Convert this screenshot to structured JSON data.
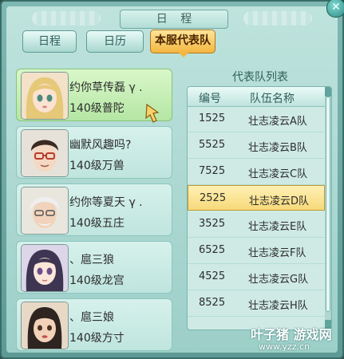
{
  "window": {
    "title": "日 程",
    "close_icon": "close-icon"
  },
  "tabs": [
    {
      "label": "日程"
    },
    {
      "label": "日历"
    },
    {
      "label": "本服代表队",
      "active": true
    }
  ],
  "team": {
    "members": [
      {
        "name": "约你草传磊 γ .",
        "level": "140级普陀",
        "avatar": "blonde-girl-avatar",
        "selected": true
      },
      {
        "name": "幽默风趣吗?",
        "level": "140级万兽",
        "avatar": "glasses-man-avatar"
      },
      {
        "name": "约你等夏天 γ .",
        "level": "140级五庄",
        "avatar": "old-man-avatar"
      },
      {
        "name": "、扈三狼",
        "level": "140级龙宫",
        "avatar": "dark-hair-girl-avatar"
      },
      {
        "name": "、扈三娘",
        "level": "140级方寸",
        "avatar": "woman-avatar"
      }
    ]
  },
  "roster": {
    "title": "代表队列表",
    "headers": [
      "编号",
      "队伍名称"
    ],
    "rows": [
      {
        "id": "1525",
        "name": "壮志凌云A队"
      },
      {
        "id": "5525",
        "name": "壮志凌云B队"
      },
      {
        "id": "7525",
        "name": "壮志凌云C队"
      },
      {
        "id": "2525",
        "name": "壮志凌云D队",
        "selected": true
      },
      {
        "id": "3525",
        "name": "壮志凌云E队"
      },
      {
        "id": "6525",
        "name": "壮志凌云F队"
      },
      {
        "id": "4525",
        "name": "壮志凌云G队"
      },
      {
        "id": "8525",
        "name": "壮志凌云H队"
      }
    ]
  },
  "watermark": {
    "main": "叶子猪 游戏网",
    "url": "www.yzz.cn"
  },
  "colors": {
    "active_tab": "#f4b640",
    "selected_row": "#f7d97a",
    "selected_member": "#b5e6a5"
  }
}
